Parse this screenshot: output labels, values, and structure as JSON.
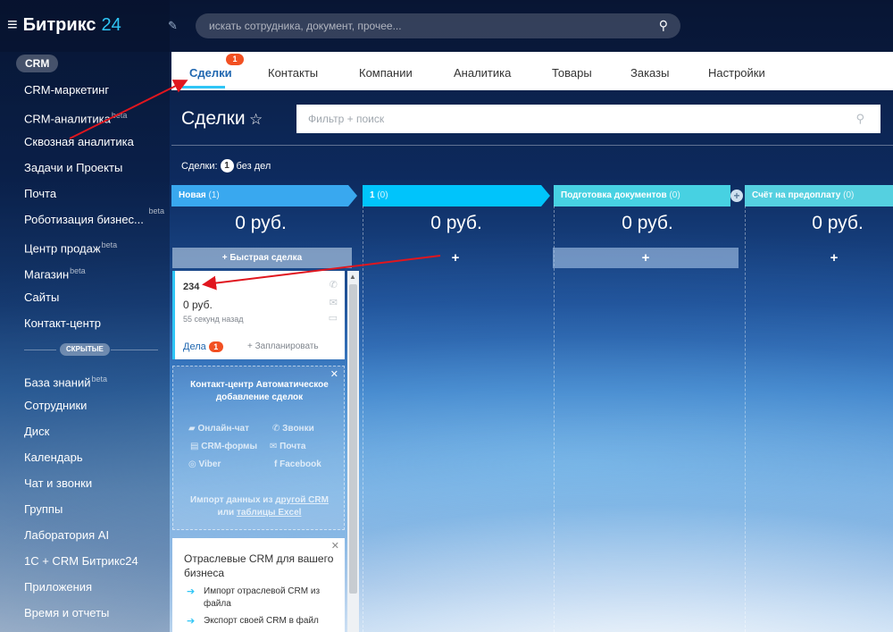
{
  "app": {
    "logo_name": "Битрикс",
    "logo_num": "24"
  },
  "search": {
    "placeholder": "искать сотрудника, документ, прочее..."
  },
  "sidebar": {
    "crm_pill": "CRM",
    "items": [
      {
        "label": "CRM-маркетинг"
      },
      {
        "label": "CRM-аналитика",
        "sup": "beta"
      },
      {
        "label": "Сквозная аналитика"
      },
      {
        "label": "Задачи и Проекты"
      },
      {
        "label": "Почта"
      },
      {
        "label": "Роботизация бизнес...",
        "beta": "beta"
      },
      {
        "label": "Центр продаж",
        "sup": "beta"
      },
      {
        "label": "Магазин",
        "sup": "beta"
      },
      {
        "label": "Сайты"
      },
      {
        "label": "Контакт-центр"
      }
    ],
    "hidden_label": "СКРЫТЫЕ",
    "hidden_items": [
      {
        "label": "База знаний",
        "sup": "beta"
      },
      {
        "label": "Сотрудники"
      },
      {
        "label": "Диск"
      },
      {
        "label": "Календарь"
      },
      {
        "label": "Чат и звонки"
      },
      {
        "label": "Группы"
      },
      {
        "label": "Лаборатория AI"
      },
      {
        "label": "1С + CRM Битрикс24"
      },
      {
        "label": "Приложения"
      },
      {
        "label": "Время и отчеты"
      }
    ]
  },
  "tabs": {
    "items": [
      "Сделки",
      "Контакты",
      "Компании",
      "Аналитика",
      "Товары",
      "Заказы",
      "Настройки"
    ],
    "badge": "1"
  },
  "page": {
    "title": "Сделки",
    "filter_placeholder": "Фильтр + поиск",
    "counter_label": "Сделки:",
    "counter_value": "1",
    "counter_suffix": "без дел"
  },
  "stages": [
    {
      "name": "Новая",
      "count": "(1)",
      "color": "#39a8ef",
      "sum": "0 руб."
    },
    {
      "name": "1",
      "count": "(0)",
      "color": "#00c4fb",
      "sum": "0 руб."
    },
    {
      "name": "Подготовка документов",
      "count": "(0)",
      "color": "#47d1e2",
      "sum": "0 руб."
    },
    {
      "name": "Счёт на предоплату",
      "count": "(0)",
      "color": "#55d0e0",
      "sum": "0 руб."
    }
  ],
  "quick_deal": "+ Быстрая сделка",
  "add_symbol": "+",
  "deal": {
    "title": "234",
    "sum": "0 руб.",
    "time": "55 секунд назад",
    "tasks_label": "Дела",
    "tasks_badge": "1",
    "plan_label": "+ Запланировать"
  },
  "promo": {
    "title": "Контакт-центр Автоматическое добавление сделок",
    "channels": [
      "Онлайн-чат",
      "Звонки",
      "CRM-формы",
      "Почта",
      "Viber",
      "Facebook"
    ],
    "import_text_1": "Импорт данных из",
    "import_link_1": "другой CRM",
    "import_text_2": "или",
    "import_link_2": "таблицы Excel"
  },
  "industry": {
    "title": "Отраслевые CRM для вашего бизнеса",
    "rows": [
      "Импорт отраслевой CRM из файла",
      "Экспорт своей CRM в файл"
    ]
  },
  "colors": {
    "accent": "#2fc6f6",
    "badge": "#f25022",
    "link": "#2067b0",
    "annotation": "#e0161e"
  }
}
